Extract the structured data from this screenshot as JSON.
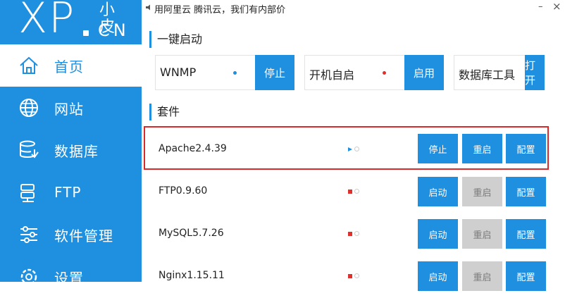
{
  "app": {
    "logo_main": "XP",
    "logo_small": "小皮",
    "logo_cn": "CN",
    "ad_text": "用阿里云 腾讯云，我们有内部价",
    "minimize_glyph": "–",
    "close_glyph": "×"
  },
  "colors": {
    "accent": "#1f8fe0",
    "highlight": "#d92b2b",
    "running": "#1f8fe0",
    "stopped": "#e0302b",
    "disabled": "#cfcfcf"
  },
  "nav": [
    {
      "label": "首页",
      "icon": "home-icon",
      "active": true
    },
    {
      "label": "网站",
      "icon": "globe-icon",
      "active": false
    },
    {
      "label": "数据库",
      "icon": "database-icon",
      "active": false
    },
    {
      "label": "FTP",
      "icon": "ftp-icon",
      "active": false
    },
    {
      "label": "软件管理",
      "icon": "sliders-icon",
      "active": false
    },
    {
      "label": "设置",
      "icon": "settings-icon",
      "active": false
    }
  ],
  "quickstart": {
    "title": "一键启动",
    "items": [
      {
        "label": "WNMP",
        "status": "running",
        "button": "停止"
      },
      {
        "label": "开机自启",
        "status": "stopped",
        "button": "启用"
      },
      {
        "label": "数据库工具",
        "status": "none",
        "button": "打开"
      }
    ]
  },
  "suite": {
    "title": "套件",
    "rows": [
      {
        "name": "Apache2.4.39",
        "status": "running",
        "btn1": "停止",
        "btn2": "重启",
        "btn3": "配置",
        "btn2_enabled": true,
        "selected": true
      },
      {
        "name": "FTP0.9.60",
        "status": "stopped",
        "btn1": "启动",
        "btn2": "重启",
        "btn3": "配置",
        "btn2_enabled": false,
        "selected": false
      },
      {
        "name": "MySQL5.7.26",
        "status": "stopped",
        "btn1": "启动",
        "btn2": "重启",
        "btn3": "配置",
        "btn2_enabled": false,
        "selected": false
      },
      {
        "name": "Nginx1.15.11",
        "status": "stopped",
        "btn1": "启动",
        "btn2": "重启",
        "btn3": "配置",
        "btn2_enabled": false,
        "selected": false
      }
    ]
  }
}
